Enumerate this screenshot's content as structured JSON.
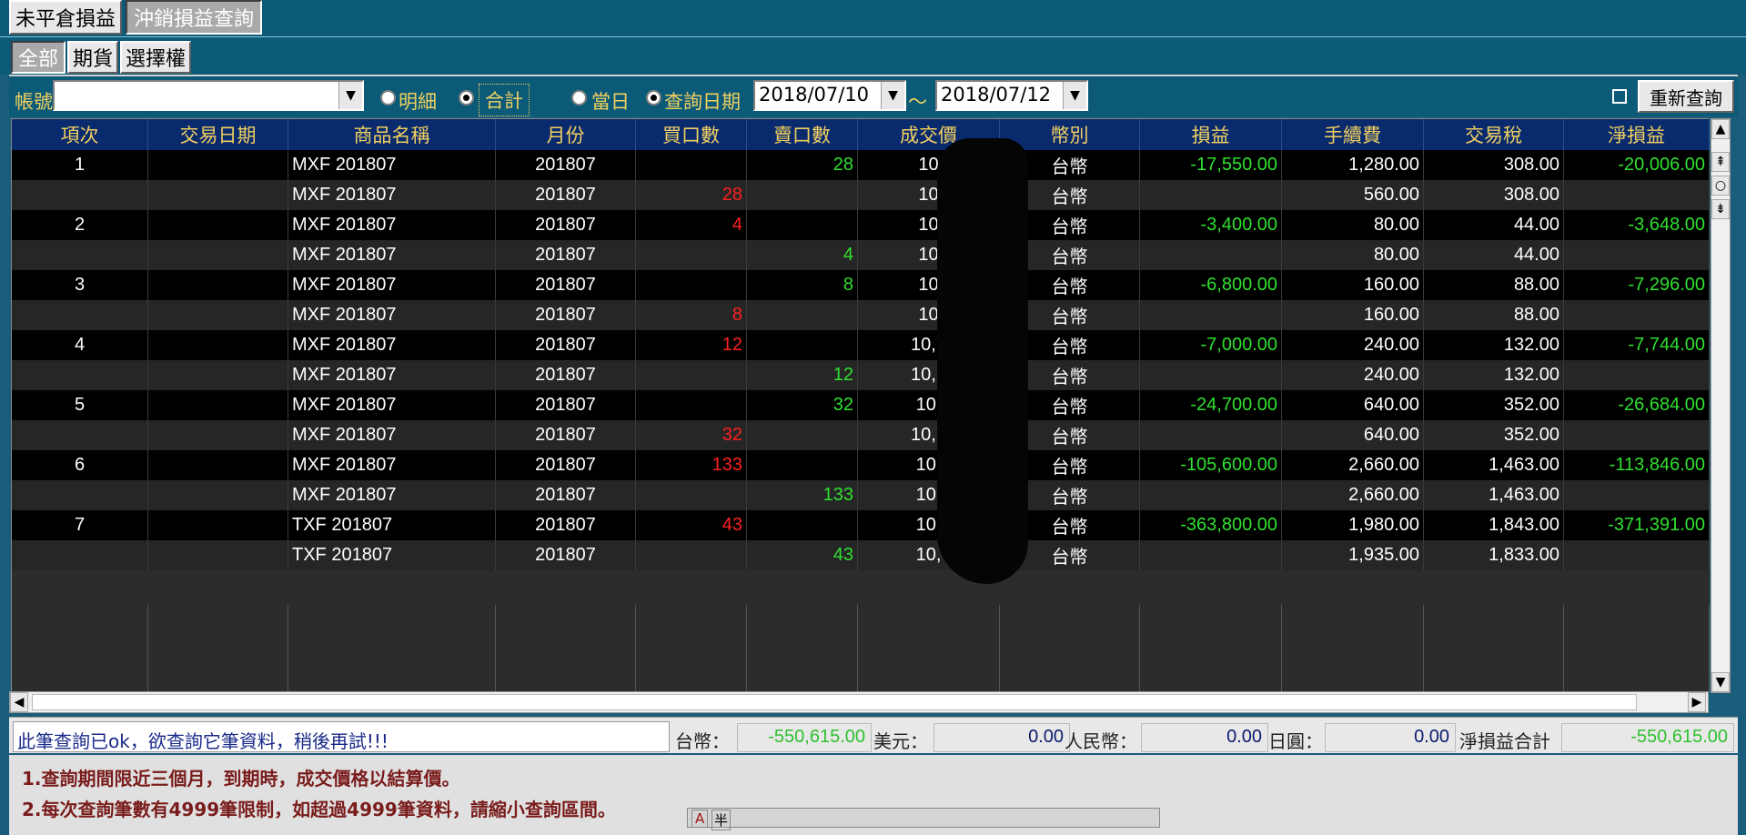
{
  "top_tabs": [
    "未平倉損益",
    "沖銷損益查詢"
  ],
  "sub_tabs": [
    "全部",
    "期貨",
    "選擇權"
  ],
  "query": {
    "account_label": "帳號",
    "radio_detail": "明細",
    "radio_total": "合計",
    "radio_today": "當日",
    "radio_query_date": "查詢日期",
    "date_from": "2018/07/10",
    "tilde": "～",
    "date_to": "2018/07/12",
    "refresh_button": "重新查詢"
  },
  "table": {
    "columns": [
      "項次",
      "交易日期",
      "商品名稱",
      "月份",
      "買口數",
      "賣口數",
      "成交價",
      "幣別",
      "損益",
      "手續費",
      "交易稅",
      "淨損益"
    ],
    "rows": [
      {
        "no": "1",
        "date": "",
        "product": "MXF 201807",
        "month": "201807",
        "buy": "",
        "sell": "28",
        "price": "10",
        "currency": "台幣",
        "pl": "-17,550.00",
        "fee": "1,280.00",
        "tax": "308.00",
        "net": "-20,006.00"
      },
      {
        "no": "",
        "date": "",
        "product": "MXF 201807",
        "month": "201807",
        "buy": "28",
        "sell": "",
        "price": "10",
        "currency": "台幣",
        "pl": "",
        "fee": "560.00",
        "tax": "308.00",
        "net": ""
      },
      {
        "no": "2",
        "date": "",
        "product": "MXF 201807",
        "month": "201807",
        "buy": "4",
        "sell": "",
        "price": "10",
        "currency": "台幣",
        "pl": "-3,400.00",
        "fee": "80.00",
        "tax": "44.00",
        "net": "-3,648.00"
      },
      {
        "no": "",
        "date": "",
        "product": "MXF 201807",
        "month": "201807",
        "buy": "",
        "sell": "4",
        "price": "10",
        "currency": "台幣",
        "pl": "",
        "fee": "80.00",
        "tax": "44.00",
        "net": ""
      },
      {
        "no": "3",
        "date": "",
        "product": "MXF 201807",
        "month": "201807",
        "buy": "",
        "sell": "8",
        "price": "10",
        "currency": "台幣",
        "pl": "-6,800.00",
        "fee": "160.00",
        "tax": "88.00",
        "net": "-7,296.00"
      },
      {
        "no": "",
        "date": "",
        "product": "MXF 201807",
        "month": "201807",
        "buy": "8",
        "sell": "",
        "price": "10",
        "currency": "台幣",
        "pl": "",
        "fee": "160.00",
        "tax": "88.00",
        "net": ""
      },
      {
        "no": "4",
        "date": "",
        "product": "MXF 201807",
        "month": "201807",
        "buy": "12",
        "sell": "",
        "price": "10,7",
        "currency": "台幣",
        "pl": "-7,000.00",
        "fee": "240.00",
        "tax": "132.00",
        "net": "-7,744.00"
      },
      {
        "no": "",
        "date": "",
        "product": "MXF 201807",
        "month": "201807",
        "buy": "",
        "sell": "12",
        "price": "10,7",
        "currency": "台幣",
        "pl": "",
        "fee": "240.00",
        "tax": "132.00",
        "net": ""
      },
      {
        "no": "5",
        "date": "",
        "product": "MXF 201807",
        "month": "201807",
        "buy": "",
        "sell": "32",
        "price": "10,",
        "currency": "台幣",
        "pl": "-24,700.00",
        "fee": "640.00",
        "tax": "352.00",
        "net": "-26,684.00"
      },
      {
        "no": "",
        "date": "",
        "product": "MXF 201807",
        "month": "201807",
        "buy": "32",
        "sell": "",
        "price": "10,7",
        "currency": "台幣",
        "pl": "",
        "fee": "640.00",
        "tax": "352.00",
        "net": ""
      },
      {
        "no": "6",
        "date": "",
        "product": "MXF 201807",
        "month": "201807",
        "buy": "133",
        "sell": "",
        "price": "10,",
        "currency": "台幣",
        "pl": "-105,600.00",
        "fee": "2,660.00",
        "tax": "1,463.00",
        "net": "-113,846.00"
      },
      {
        "no": "",
        "date": "",
        "product": "MXF 201807",
        "month": "201807",
        "buy": "",
        "sell": "133",
        "price": "10,",
        "currency": "台幣",
        "pl": "",
        "fee": "2,660.00",
        "tax": "1,463.00",
        "net": ""
      },
      {
        "no": "7",
        "date": "",
        "product": "TXF 201807",
        "month": "201807",
        "buy": "43",
        "sell": "",
        "price": "10,",
        "currency": "台幣",
        "pl": "-363,800.00",
        "fee": "1,980.00",
        "tax": "1,843.00",
        "net": "-371,391.00"
      },
      {
        "no": "",
        "date": "",
        "product": "TXF 201807",
        "month": "201807",
        "buy": "",
        "sell": "43",
        "price": "10,",
        "currency": "台幣",
        "pl": "",
        "fee": "1,935.00",
        "tax": "1,833.00",
        "net": ""
      }
    ]
  },
  "totals": {
    "status": "此筆查詢已ok，欲查詢它筆資料，稍後再試!!!",
    "twd_label": "台幣：",
    "twd_value": "-550,615.00",
    "usd_label": "美元：",
    "usd_value": "0.00",
    "rmb_label": "人民幣：",
    "rmb_value": "0.00",
    "jpy_label": "日圓：",
    "jpy_value": "0.00",
    "net_label": "淨損益合計",
    "net_value": "-550,615.00"
  },
  "notes": [
    "1.查詢期間限近三個月，到期時，成交價格以結算價。",
    "2.每次查詢筆數有4999筆限制，如超過4999筆資料，請縮小查詢區間。"
  ],
  "ime": {
    "a": "A",
    "half": "半"
  }
}
